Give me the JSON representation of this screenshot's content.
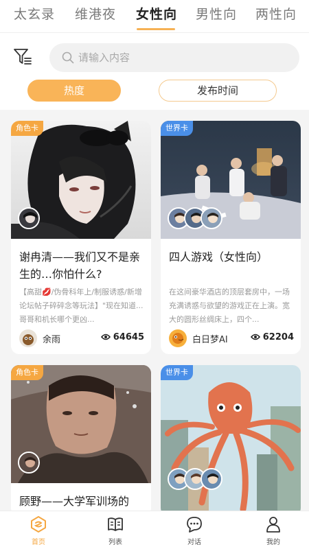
{
  "category_tabs": [
    "太玄录",
    "维港夜",
    "女性向",
    "男性向",
    "两性向"
  ],
  "active_tab": "女性向",
  "search": {
    "placeholder": "请输入内容"
  },
  "sort": {
    "hot_label": "热度",
    "time_label": "发布时间",
    "active": "热度"
  },
  "colors": {
    "accent": "#f9b458",
    "role_badge": "#f5a742",
    "world_badge": "#4a8fe8"
  },
  "cards": [
    {
      "badge": "角色卡",
      "title": "谢冉清——我们又不是亲生的…你怕什么?",
      "desc_prefix": "【高甜",
      "desc_heart": "💋",
      "desc_rest": "/伪骨科年上/制服诱惑/新增论坛帖子碎碎念等玩法】\"现在知道...哥哥和机长哪个更凶...",
      "author": "余雨",
      "views": "64645"
    },
    {
      "badge": "世界卡",
      "title": "四人游戏（女性向）",
      "desc": "在这间豪华酒店的顶层套房中，一场充满诱惑与欲望的游戏正在上演。宽大的圆形丝绸床上，四个...",
      "author": "白日梦AI",
      "views": "62204"
    },
    {
      "badge": "角色卡",
      "title": "顾野——大学军训场的"
    },
    {
      "badge": "世界卡"
    }
  ],
  "bottom_nav": [
    {
      "label": "首页",
      "icon": "home-icon",
      "active": true
    },
    {
      "label": "列表",
      "icon": "book-icon",
      "active": false
    },
    {
      "label": "对话",
      "icon": "chat-icon",
      "active": false
    },
    {
      "label": "我的",
      "icon": "user-icon",
      "active": false
    }
  ]
}
